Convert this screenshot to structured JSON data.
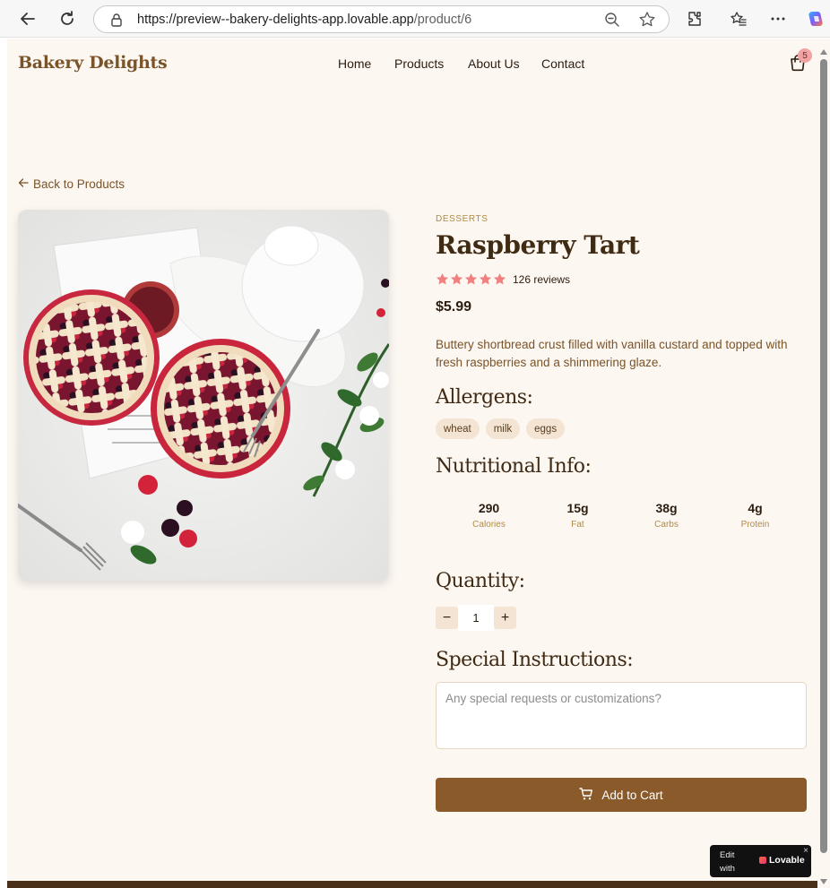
{
  "browser": {
    "url_main": "https://preview--bakery-delights-app.lovable.app",
    "url_path": "/product/6"
  },
  "header": {
    "brand": "Bakery Delights",
    "nav": [
      "Home",
      "Products",
      "About Us",
      "Contact"
    ],
    "cart_count": "5"
  },
  "back_link": "Back to Products",
  "product": {
    "category": "DESSERTS",
    "title": "Raspberry Tart",
    "rating": 5,
    "reviews": "126 reviews",
    "price": "$5.99",
    "description": "Buttery shortbread crust filled with vanilla custard and topped with fresh raspberries and a shimmering glaze."
  },
  "allergens": {
    "heading": "Allergens:",
    "items": [
      "wheat",
      "milk",
      "eggs"
    ]
  },
  "nutrition": {
    "heading": "Nutritional Info:",
    "items": [
      {
        "value": "290",
        "label": "Calories"
      },
      {
        "value": "15g",
        "label": "Fat"
      },
      {
        "value": "38g",
        "label": "Carbs"
      },
      {
        "value": "4g",
        "label": "Protein"
      }
    ]
  },
  "quantity": {
    "heading": "Quantity:",
    "minus": "−",
    "value": "1",
    "plus": "+"
  },
  "instructions": {
    "heading": "Special Instructions:",
    "placeholder": "Any special requests or customizations?"
  },
  "add_to_cart": "Add to Cart",
  "lovable_badge": {
    "edit_line1": "Edit",
    "edit_line2": "with",
    "brand": "Lovable",
    "close": "×"
  },
  "colors": {
    "page_bg": "#fdf7f1",
    "brand": "#7a5328",
    "title": "#3f2a14",
    "button": "#8a5a2b",
    "chip": "#f3e4d4",
    "star": "#f08080"
  }
}
